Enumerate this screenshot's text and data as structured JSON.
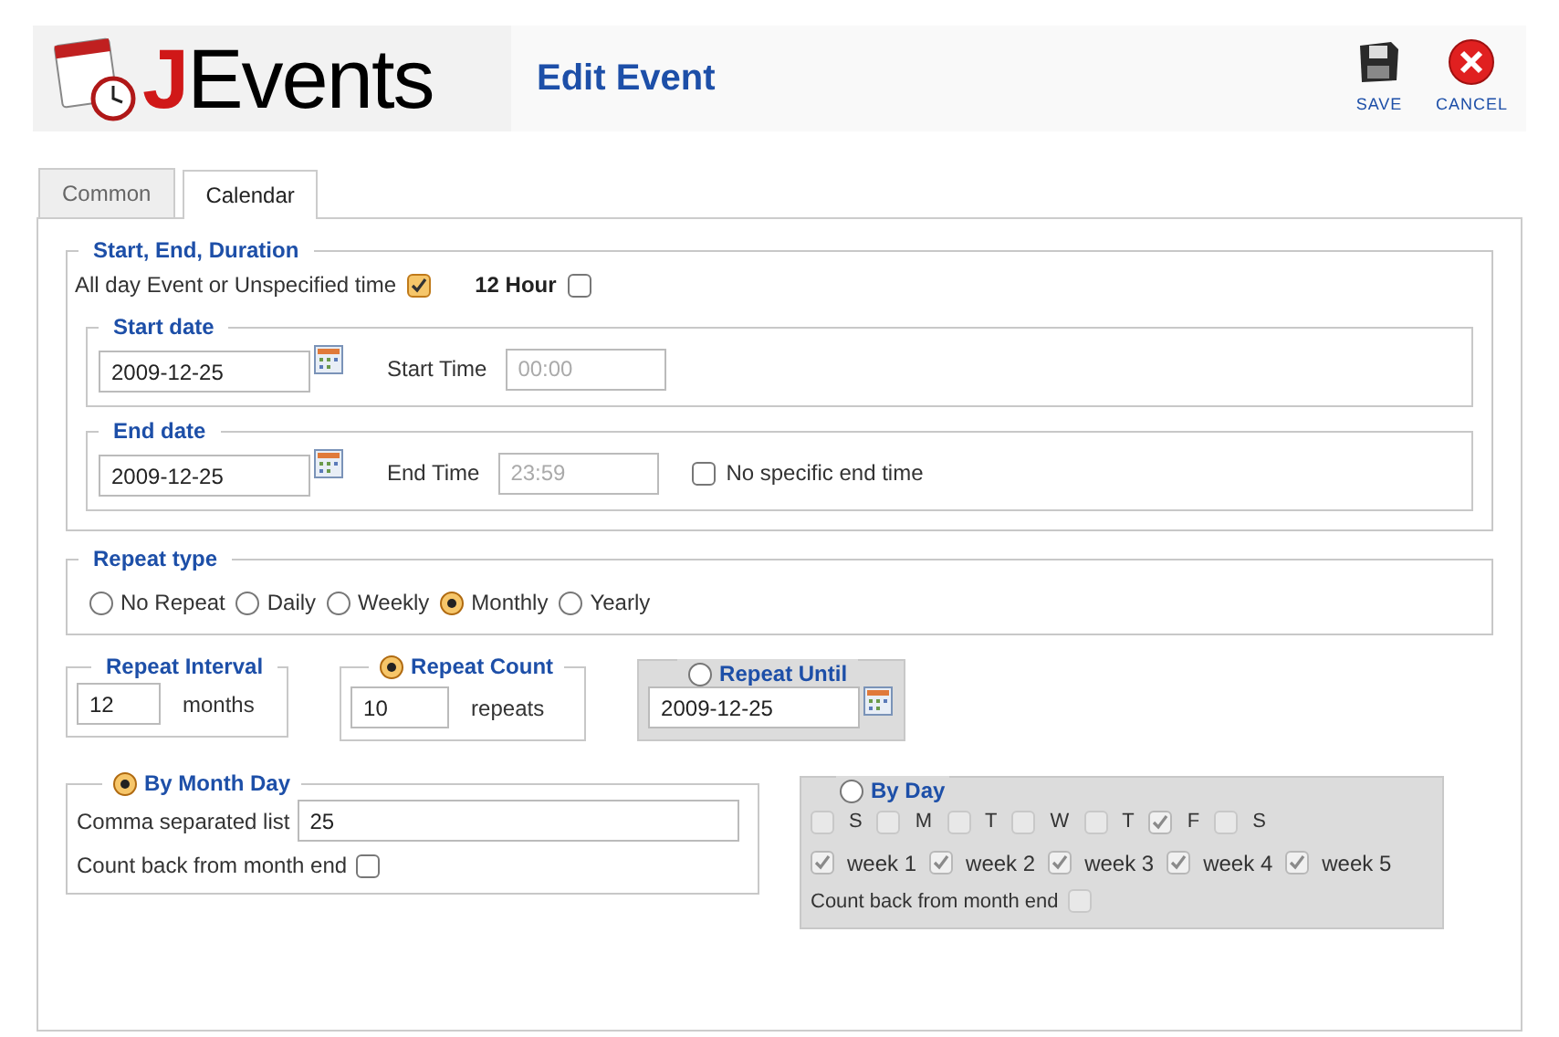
{
  "header": {
    "logo_initial": "J",
    "logo_rest": "Events",
    "title": "Edit Event",
    "toolbar": [
      {
        "kind": "save",
        "label": "SAVE"
      },
      {
        "kind": "cancel",
        "label": "CANCEL"
      }
    ]
  },
  "tabs": [
    {
      "label": "Common",
      "selected": false
    },
    {
      "label": "Calendar",
      "selected": true
    }
  ],
  "start_end_duration": {
    "legend": "Start, End, Duration",
    "all_day": {
      "label": "All day Event or Unspecified time",
      "checked": true
    },
    "twelve_hour": {
      "label": "12 Hour",
      "checked": false
    },
    "start": {
      "legend": "Start date",
      "date": "2009-12-25",
      "time_label": "Start Time",
      "time": "00:00",
      "time_disabled": true
    },
    "end": {
      "legend": "End date",
      "date": "2009-12-25",
      "time_label": "End Time",
      "time": "23:59",
      "time_disabled": true,
      "no_end": {
        "label": "No specific end time",
        "checked": false
      }
    }
  },
  "repeat_type": {
    "legend": "Repeat type",
    "options": [
      {
        "label": "No Repeat",
        "selected": false
      },
      {
        "label": "Daily",
        "selected": false
      },
      {
        "label": "Weekly",
        "selected": false
      },
      {
        "label": "Monthly",
        "selected": true
      },
      {
        "label": "Yearly",
        "selected": false
      }
    ]
  },
  "repeat_interval": {
    "legend": "Repeat Interval",
    "value": "12",
    "unit": "months"
  },
  "repeat_count": {
    "legend": "Repeat Count",
    "selected": true,
    "value": "10",
    "unit": "repeats"
  },
  "repeat_until": {
    "legend": "Repeat Until",
    "selected": false,
    "date": "2009-12-25"
  },
  "by_month_day": {
    "legend": "By Month Day",
    "selected": true,
    "list_label": "Comma separated list",
    "list": "25",
    "count_back": {
      "label": "Count back from month end",
      "checked": false
    }
  },
  "by_day": {
    "legend": "By Day",
    "selected": false,
    "days": [
      {
        "label": "S",
        "checked": false
      },
      {
        "label": "M",
        "checked": false
      },
      {
        "label": "T",
        "checked": false
      },
      {
        "label": "W",
        "checked": false
      },
      {
        "label": "T",
        "checked": false
      },
      {
        "label": "F",
        "checked": true
      },
      {
        "label": "S",
        "checked": false
      }
    ],
    "weeks": [
      {
        "label": "week 1",
        "checked": true
      },
      {
        "label": "week 2",
        "checked": true
      },
      {
        "label": "week 3",
        "checked": true
      },
      {
        "label": "week 4",
        "checked": true
      },
      {
        "label": "week 5",
        "checked": true
      }
    ],
    "count_back": {
      "label": "Count back from month end",
      "checked": false
    }
  }
}
